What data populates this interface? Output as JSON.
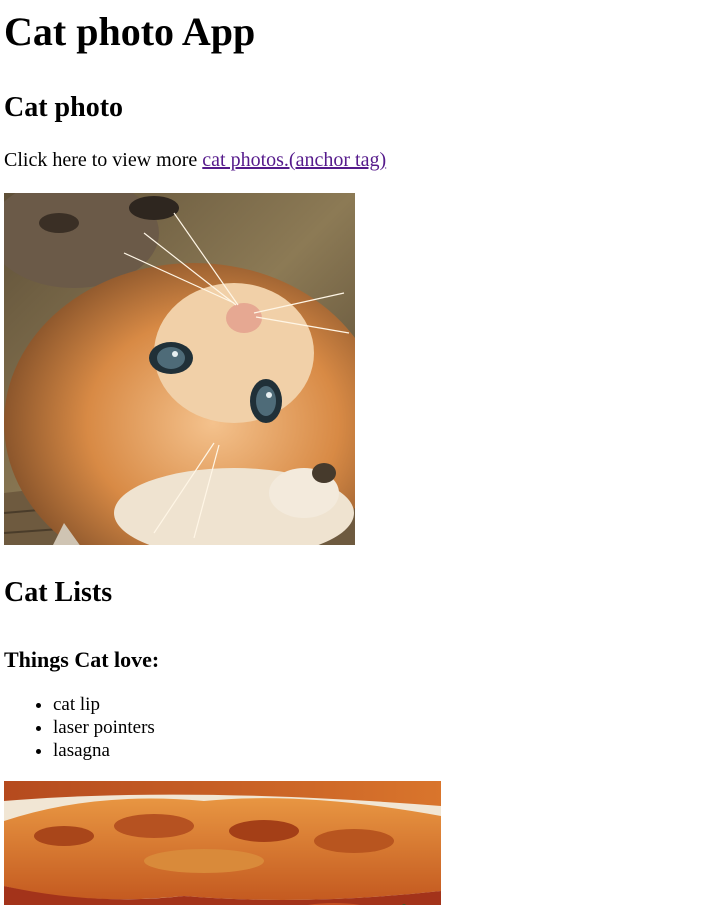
{
  "page": {
    "title": "Cat photo App"
  },
  "cat_photo_section": {
    "heading": "Cat photo",
    "intro_text": "Click here to view more ",
    "link_text": "cat photos.(anchor tag)"
  },
  "cat_lists_section": {
    "heading": "Cat Lists",
    "subheading": "Things Cat love:",
    "items": [
      "cat lip",
      "laser pointers",
      "lasagna"
    ]
  },
  "colors": {
    "link": "#551a8b",
    "text": "#000000",
    "background": "#ffffff"
  }
}
